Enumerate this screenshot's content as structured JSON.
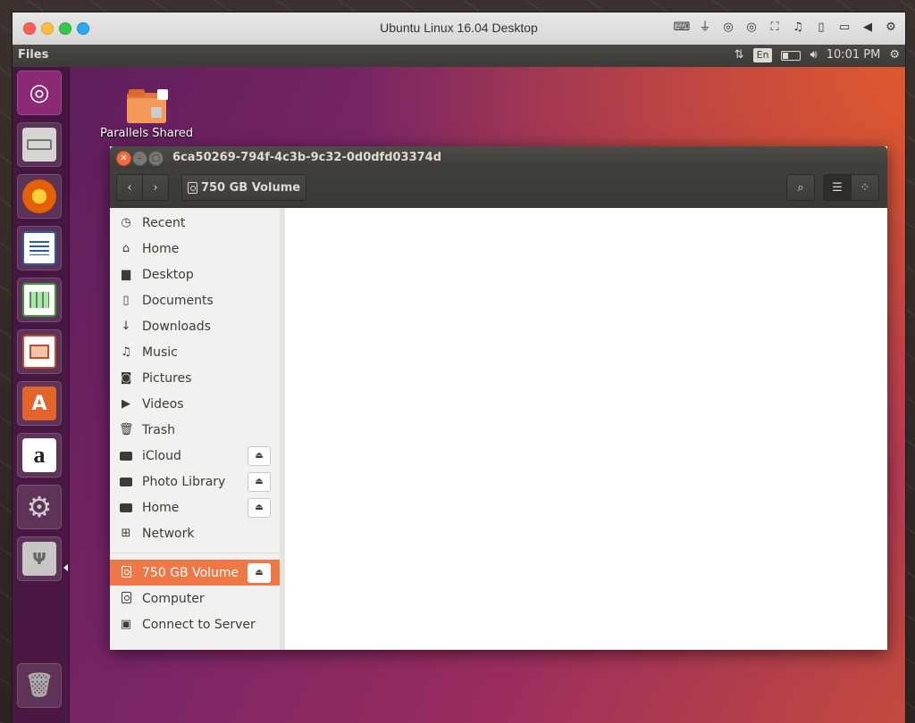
{
  "mac": {
    "title": "Ubuntu Linux 16.04 Desktop",
    "toolbar_icons": [
      "keyboard-icon",
      "usb-icon",
      "cd-icon",
      "cd-icon",
      "network-icon",
      "sound-icon",
      "device-icon",
      "folder-sync-icon",
      "arrow-left-icon",
      "gear-icon"
    ]
  },
  "panel": {
    "app_name": "Files",
    "lang": "En",
    "time": "10:01 PM"
  },
  "launcher": {
    "items": [
      "ubuntu-dash",
      "files",
      "firefox",
      "libreoffice-writer",
      "libreoffice-calc",
      "libreoffice-impress",
      "ubuntu-software",
      "amazon",
      "system-settings",
      "usb-drive",
      "trash"
    ]
  },
  "desktop": {
    "icon_label": "Parallels Shared"
  },
  "window": {
    "title": "6ca50269-794f-4c3b-9c32-0d0dfd03374d",
    "path": "750 GB Volume"
  },
  "sidebar": {
    "items": [
      {
        "label": "Recent",
        "icon": "clock-icon"
      },
      {
        "label": "Home",
        "icon": "home-icon"
      },
      {
        "label": "Desktop",
        "icon": "folder-icon"
      },
      {
        "label": "Documents",
        "icon": "document-icon"
      },
      {
        "label": "Downloads",
        "icon": "download-icon"
      },
      {
        "label": "Music",
        "icon": "music-icon"
      },
      {
        "label": "Pictures",
        "icon": "camera-icon"
      },
      {
        "label": "Videos",
        "icon": "video-icon"
      },
      {
        "label": "Trash",
        "icon": "trash-icon"
      },
      {
        "label": "iCloud",
        "icon": "drive-icon"
      },
      {
        "label": "Photo Library",
        "icon": "drive-icon"
      },
      {
        "label": "Home",
        "icon": "drive-icon"
      },
      {
        "label": "Network",
        "icon": "network-icon"
      },
      {
        "label": "750 GB Volume",
        "icon": "disk-icon"
      },
      {
        "label": "Computer",
        "icon": "disk-icon"
      },
      {
        "label": "Connect to Server",
        "icon": "server-icon"
      }
    ]
  },
  "colors": {
    "accent": "#f07746",
    "titlebar": "#3d3c38"
  }
}
